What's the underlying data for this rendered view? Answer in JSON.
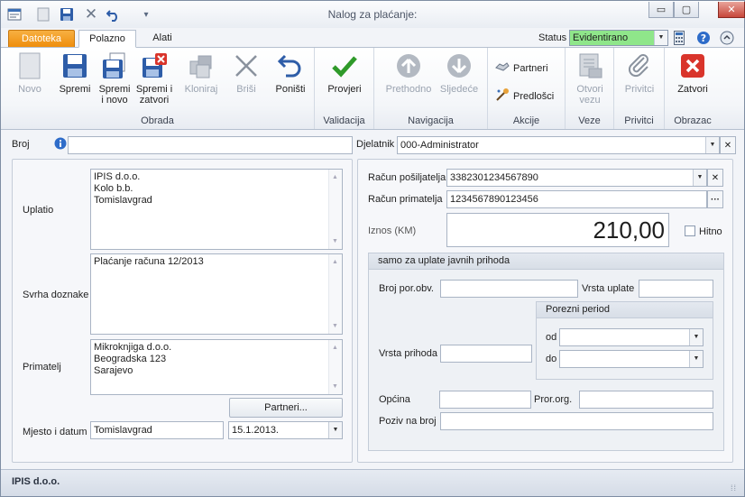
{
  "window": {
    "title": "Nalog za plaćanje:",
    "minimize": "▭",
    "maximize": "▢",
    "close": "✕"
  },
  "quick_access": {
    "menu": "▾"
  },
  "tabs": {
    "datoteka": "Datoteka",
    "polazno": "Polazno",
    "alati": "Alati"
  },
  "status": {
    "label": "Status",
    "value": "Evidentirano",
    "color": "#8fe68a"
  },
  "ribbon": {
    "obrada": {
      "label": "Obrada",
      "novo": "Novo",
      "spremi": "Spremi",
      "spremi_novo_1": "Spremi",
      "spremi_novo_2": "i novo",
      "spremi_zatvori_1": "Spremi i",
      "spremi_zatvori_2": "zatvori",
      "kloniraj": "Kloniraj",
      "brisi": "Briši",
      "ponisti": "Poništi"
    },
    "validacija": {
      "label": "Validacija",
      "provjeri": "Provjeri"
    },
    "navigacija": {
      "label": "Navigacija",
      "prethodno": "Prethodno",
      "sljedece": "Sljedeće"
    },
    "akcije": {
      "label": "Akcije",
      "partneri": "Partneri",
      "predlosci": "Predlošci"
    },
    "veze": {
      "label": "Veze",
      "otvori_1": "Otvori",
      "otvori_2": "vezu"
    },
    "privitci": {
      "label": "Privitci",
      "privitci": "Privitci"
    },
    "obrazac": {
      "label": "Obrazac",
      "zatvori": "Zatvori"
    }
  },
  "form": {
    "broj_label": "Broj",
    "broj_value": "",
    "djelatnik_label": "Djelatnik",
    "djelatnik_value": "000-Administrator",
    "uplatio_label": "Uplatio",
    "uplatio_lines": [
      "IPIS d.o.o.",
      "Kolo b.b.",
      "Tomislavgrad"
    ],
    "svrha_label": "Svrha doznake",
    "svrha_lines": [
      "Plaćanje računa 12/2013"
    ],
    "primatelj_label": "Primatelj",
    "primatelj_lines": [
      "Mikroknjiga d.o.o.",
      "Beogradska 123",
      "Sarajevo"
    ],
    "partneri_button": "Partneri...",
    "mjesto_label": "Mjesto i datum",
    "mjesto_value": "Tomislavgrad",
    "datum_value": "15.1.2013.",
    "racun_posiljatelja_label": "Račun pošiljatelja",
    "racun_posiljatelja_value": "3382301234567890",
    "racun_primatelja_label": "Račun primatelja",
    "racun_primatelja_value": "1234567890123456",
    "iznos_label": "Iznos (KM)",
    "iznos_value": "210,00",
    "hitno_label": "Hitno",
    "hitno_checked": false,
    "javni_prihodi_title": "samo za uplate javnih prihoda",
    "broj_por_obv_label": "Broj por.obv.",
    "vrsta_uplate_label": "Vrsta uplate",
    "porezni_period_label": "Porezni period",
    "vrsta_prihoda_label": "Vrsta prihoda",
    "od_label": "od",
    "do_label": "do",
    "opcina_label": "Općina",
    "pror_org_label": "Pror.org.",
    "poziv_label": "Poziv na broj"
  },
  "statusbar": {
    "company": "IPIS d.o.o."
  }
}
